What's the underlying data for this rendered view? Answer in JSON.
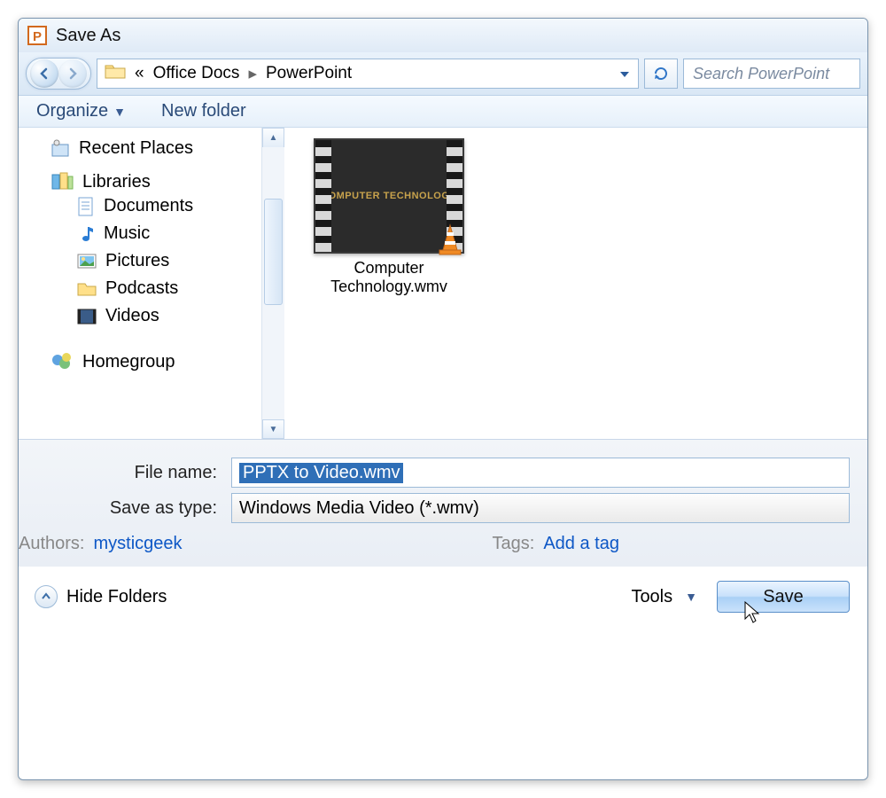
{
  "title": "Save As",
  "breadcrumb": {
    "prefix": "«",
    "parent": "Office Docs",
    "current": "PowerPoint"
  },
  "search": {
    "placeholder": "Search PowerPoint"
  },
  "toolbar": {
    "organize": "Organize",
    "newfolder": "New folder"
  },
  "sidebar": {
    "recent": "Recent Places",
    "libraries_header": "Libraries",
    "items": [
      {
        "label": "Documents"
      },
      {
        "label": "Music"
      },
      {
        "label": "Pictures"
      },
      {
        "label": "Podcasts"
      },
      {
        "label": "Videos"
      }
    ],
    "homegroup": "Homegroup"
  },
  "content": {
    "file_label_line1": "Computer",
    "file_label_line2": "Technology.wmv",
    "thumb_text": "OMPUTER TECHNOLOG"
  },
  "form": {
    "filename_label": "File name:",
    "filename_value": "PPTX to Video.wmv",
    "type_label": "Save as type:",
    "type_value": "Windows Media Video (*.wmv)",
    "authors_label": "Authors:",
    "authors_value": "mysticgeek",
    "tags_label": "Tags:",
    "tags_value": "Add a tag"
  },
  "footer": {
    "hide": "Hide Folders",
    "tools": "Tools",
    "save": "Save"
  }
}
